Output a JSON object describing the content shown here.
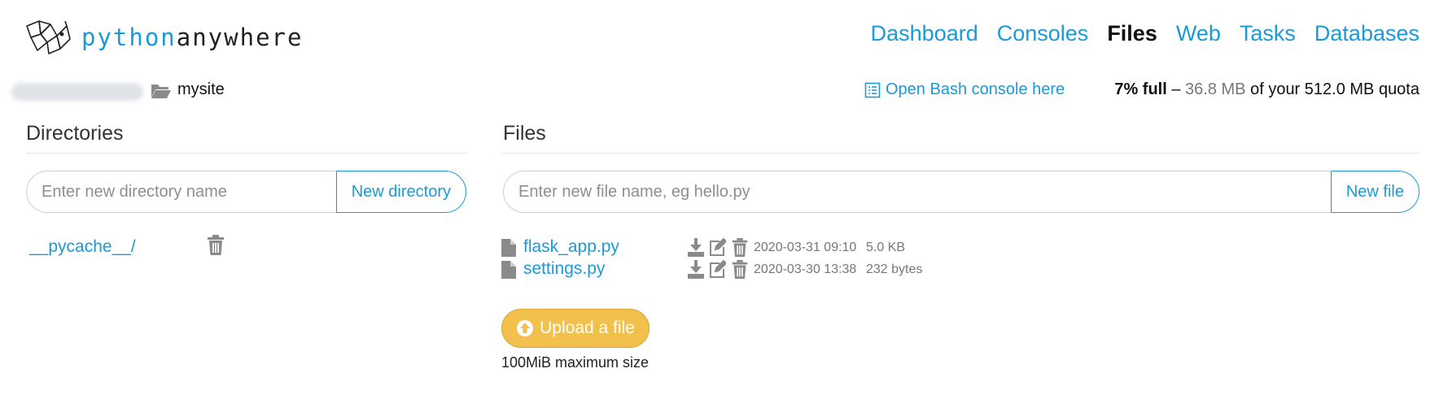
{
  "brand": {
    "part1": "python",
    "part2": "anywhere"
  },
  "nav": [
    {
      "label": "Dashboard",
      "active": false
    },
    {
      "label": "Consoles",
      "active": false
    },
    {
      "label": "Files",
      "active": true
    },
    {
      "label": "Web",
      "active": false
    },
    {
      "label": "Tasks",
      "active": false
    },
    {
      "label": "Databases",
      "active": false
    }
  ],
  "path": {
    "current_dir": "mysite"
  },
  "bash_console": {
    "label": "Open Bash console here"
  },
  "quota": {
    "full": "7% full",
    "dash": "–",
    "used": "36.8 MB",
    "rest": "of your 512.0 MB quota"
  },
  "directories": {
    "title": "Directories",
    "input_placeholder": "Enter new directory name",
    "button_label": "New directory",
    "items": [
      {
        "name": "__pycache__/"
      }
    ]
  },
  "files": {
    "title": "Files",
    "input_placeholder": "Enter new file name, eg hello.py",
    "button_label": "New file",
    "items": [
      {
        "name": "flask_app.py",
        "modified": "2020-03-31 09:10",
        "size": "5.0 KB"
      },
      {
        "name": "settings.py",
        "modified": "2020-03-30 13:38",
        "size": "232 bytes"
      }
    ]
  },
  "upload": {
    "label": "Upload a file",
    "note": "100MiB maximum size"
  },
  "colors": {
    "accent": "#1a9ad6",
    "upload": "#f2c04c",
    "muted": "#777777"
  }
}
